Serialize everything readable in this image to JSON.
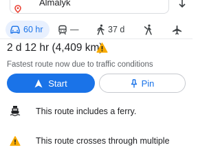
{
  "destination": {
    "value": "Almalyk",
    "icon": "location-pin-icon",
    "color": "#ea4335"
  },
  "modes": [
    {
      "name": "drive",
      "icon": "car-icon",
      "label": "60 hr",
      "active": true
    },
    {
      "name": "transit",
      "icon": "train-icon",
      "label": "—",
      "active": false
    },
    {
      "name": "walk",
      "icon": "walk-icon",
      "label": "37 d",
      "active": false
    },
    {
      "name": "ride",
      "icon": "ride-icon",
      "label": "",
      "active": false
    },
    {
      "name": "flight",
      "icon": "plane-icon",
      "label": "",
      "active": false
    }
  ],
  "route": {
    "duration": "2 d 12 hr",
    "distance": "(4,409 km)",
    "subtitle": "Fastest route now due to traffic conditions"
  },
  "buttons": {
    "start_label": "Start",
    "pin_label": "Pin"
  },
  "notices": [
    {
      "icon": "ferry-icon",
      "text": "This route includes a ferry."
    },
    {
      "icon": "warning-icon",
      "text": "This route crosses through multiple"
    }
  ],
  "colors": {
    "accent": "#1a73e8",
    "accent_bg": "#e8f0fe",
    "warning": "#f9ab00"
  }
}
